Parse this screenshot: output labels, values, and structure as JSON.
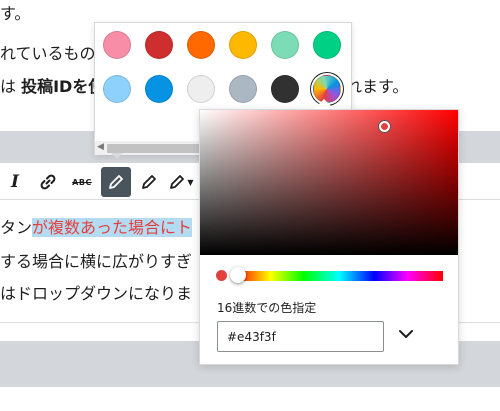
{
  "editor": {
    "line1": "す。",
    "line2": "れているもの",
    "line2_tail": "。",
    "line3_pre": "は ",
    "line3_bold": "投稿IDを使",
    "line3_post": "れます。",
    "content_line1_a": "タン",
    "content_line1_b": "が複数あった場合にト",
    "content_line2": "する場合に横に広がりすぎ",
    "content_line3": "はドロップダウンになりま"
  },
  "toolbar": {
    "italic_icon": "italic-icon",
    "link_icon": "link-icon",
    "strikethrough_label": "ABC",
    "active_tool": "text-color"
  },
  "swatches": [
    {
      "name": "pink",
      "color": "#f78da7"
    },
    {
      "name": "vivid-red",
      "color": "#cf2e2e"
    },
    {
      "name": "vivid-orange",
      "color": "#ff6900"
    },
    {
      "name": "amber",
      "color": "#fcb900"
    },
    {
      "name": "light-green-cyan",
      "color": "#7bdcb5"
    },
    {
      "name": "vivid-green-cyan",
      "color": "#00d084"
    },
    {
      "name": "pale-cyan-blue",
      "color": "#8ed1fc"
    },
    {
      "name": "vivid-cyan-blue",
      "color": "#0693e3"
    },
    {
      "name": "very-light-gray",
      "color": "#eeeeee"
    },
    {
      "name": "cyan-bluish-gray",
      "color": "#abb8c3"
    },
    {
      "name": "very-dark-gray",
      "color": "#313131"
    },
    {
      "name": "custom",
      "color": "custom-gradient"
    }
  ],
  "picker": {
    "hue_color": "#ff0000",
    "current_color": "#e43f3f",
    "hue_position": 0,
    "hex_label": "16進数での色指定",
    "hex_value": "#e43f3f"
  }
}
